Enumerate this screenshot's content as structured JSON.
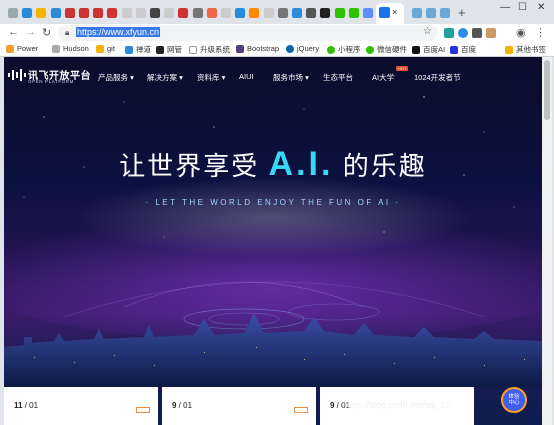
{
  "browser": {
    "address_url": "https://www.xfyun.cn",
    "bookmarks": [
      "Power",
      "Hudson",
      "git",
      "禅道",
      "网管",
      "升级系统",
      "Bootstrap",
      "jQuery",
      "小程序",
      "微信硬件",
      "百度AI",
      "百度",
      "其他书签"
    ],
    "tab_close_label": "×",
    "new_tab_label": "+"
  },
  "site": {
    "logo_title": "讯飞开放平台",
    "logo_subtitle": "OPEN PLATFORM",
    "nav": [
      {
        "label": "产品服务",
        "dropdown": true
      },
      {
        "label": "解决方案",
        "dropdown": true
      },
      {
        "label": "资料库",
        "dropdown": true
      },
      {
        "label": "AIUI",
        "dropdown": false
      },
      {
        "label": "服务市场",
        "dropdown": true
      },
      {
        "label": "生态平台",
        "dropdown": false
      },
      {
        "label": "AI大学",
        "dropdown": false
      },
      {
        "label": "1024开发者节",
        "dropdown": false
      }
    ],
    "hot_badge": "HOT"
  },
  "hero": {
    "title_before": "让世界享受",
    "title_highlight": "A.I.",
    "title_after": "的乐趣",
    "subtitle": "LET THE WORLD ENJOY THE FUN OF AI"
  },
  "cards": [
    {
      "date_main": "11",
      "date_rest": " / 01"
    },
    {
      "date_main": "9",
      "date_rest": " / 01"
    },
    {
      "date_main": "9",
      "date_rest": " / 01"
    }
  ],
  "float_bubble": {
    "line1": "体验",
    "line2": "中心"
  },
  "watermark": "https://blog.csdn.net/qq_37"
}
